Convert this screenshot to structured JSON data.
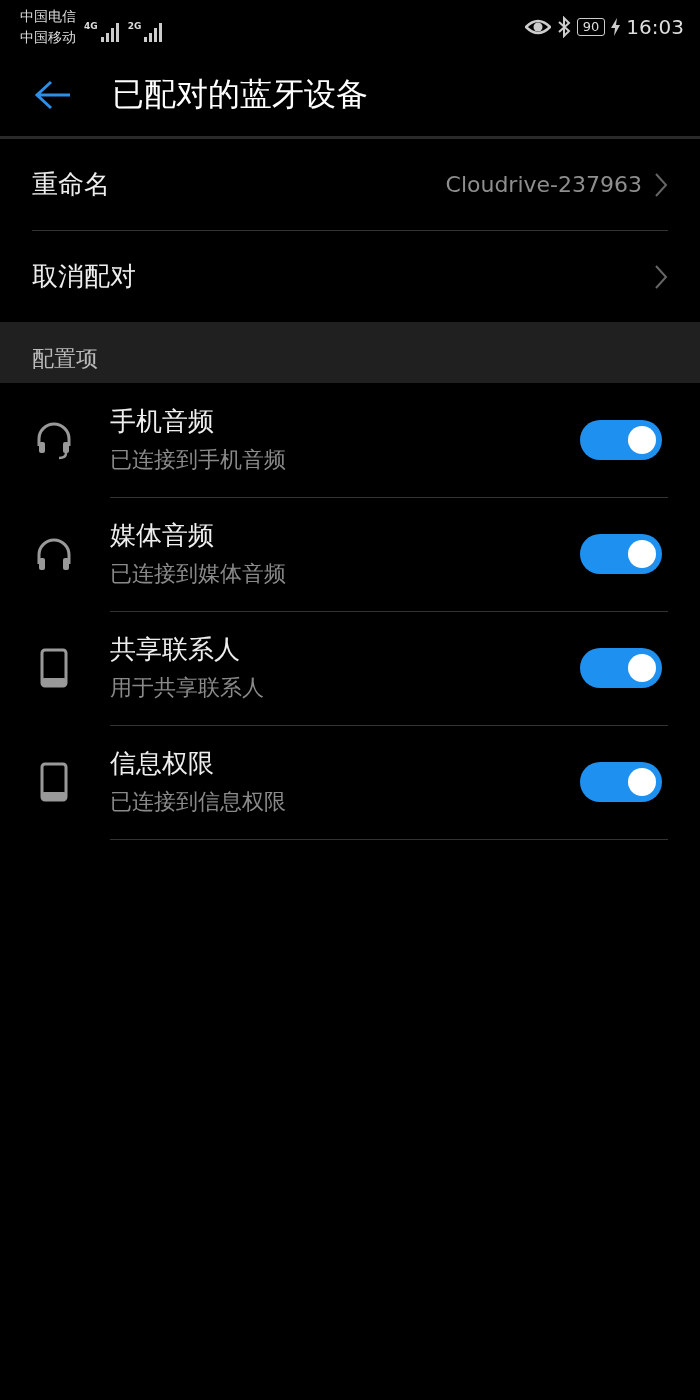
{
  "status_bar": {
    "carriers": [
      {
        "name": "中国电信",
        "network": "4G"
      },
      {
        "name": "中国移动",
        "network": "2G"
      }
    ],
    "battery": "90",
    "charging": true,
    "time": "16:03"
  },
  "header": {
    "title": "已配对的蓝牙设备"
  },
  "actions": [
    {
      "label": "重命名",
      "value": "Cloudrive-237963"
    },
    {
      "label": "取消配对"
    }
  ],
  "section": {
    "title": "配置项"
  },
  "profiles": [
    {
      "kind": "headset",
      "title": "手机音频",
      "subtitle": "已连接到手机音频",
      "on": true
    },
    {
      "kind": "headphones",
      "title": "媒体音频",
      "subtitle": "已连接到媒体音频",
      "on": true
    },
    {
      "kind": "phone",
      "title": "共享联系人",
      "subtitle": "用于共享联系人",
      "on": true
    },
    {
      "kind": "phone",
      "title": "信息权限",
      "subtitle": "已连接到信息权限",
      "on": true
    }
  ]
}
